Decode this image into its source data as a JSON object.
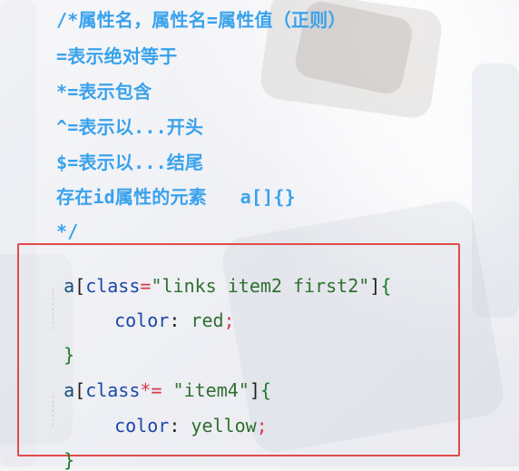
{
  "comment_lines": [
    "/*属性名，属性名=属性值（正则）",
    "=表示绝对等于",
    "*=表示包含",
    "^=表示以...开头",
    "$=表示以...结尾",
    "存在id属性的元素   a[]{}",
    "*/"
  ],
  "code": {
    "rule1": {
      "selector_a": "a",
      "bracket_open": "[",
      "attr": "class",
      "op": "=",
      "value": "\"links item2 first2\"",
      "bracket_close": "]",
      "brace_open": "{",
      "prop": "color",
      "colon": ":",
      "prop_value": "red",
      "semicolon": ";",
      "brace_close": "}"
    },
    "rule2": {
      "selector_a": "a",
      "bracket_open": "[",
      "attr": "class",
      "op": "*=",
      "value": "\"item4\"",
      "bracket_close": "]",
      "brace_open": "{",
      "prop": "color",
      "colon": ":",
      "prop_value": "yellow",
      "semicolon": ";",
      "brace_close": "}"
    }
  },
  "colors": {
    "comment": "#39a2ec",
    "highlight_border": "#e04a4a"
  }
}
